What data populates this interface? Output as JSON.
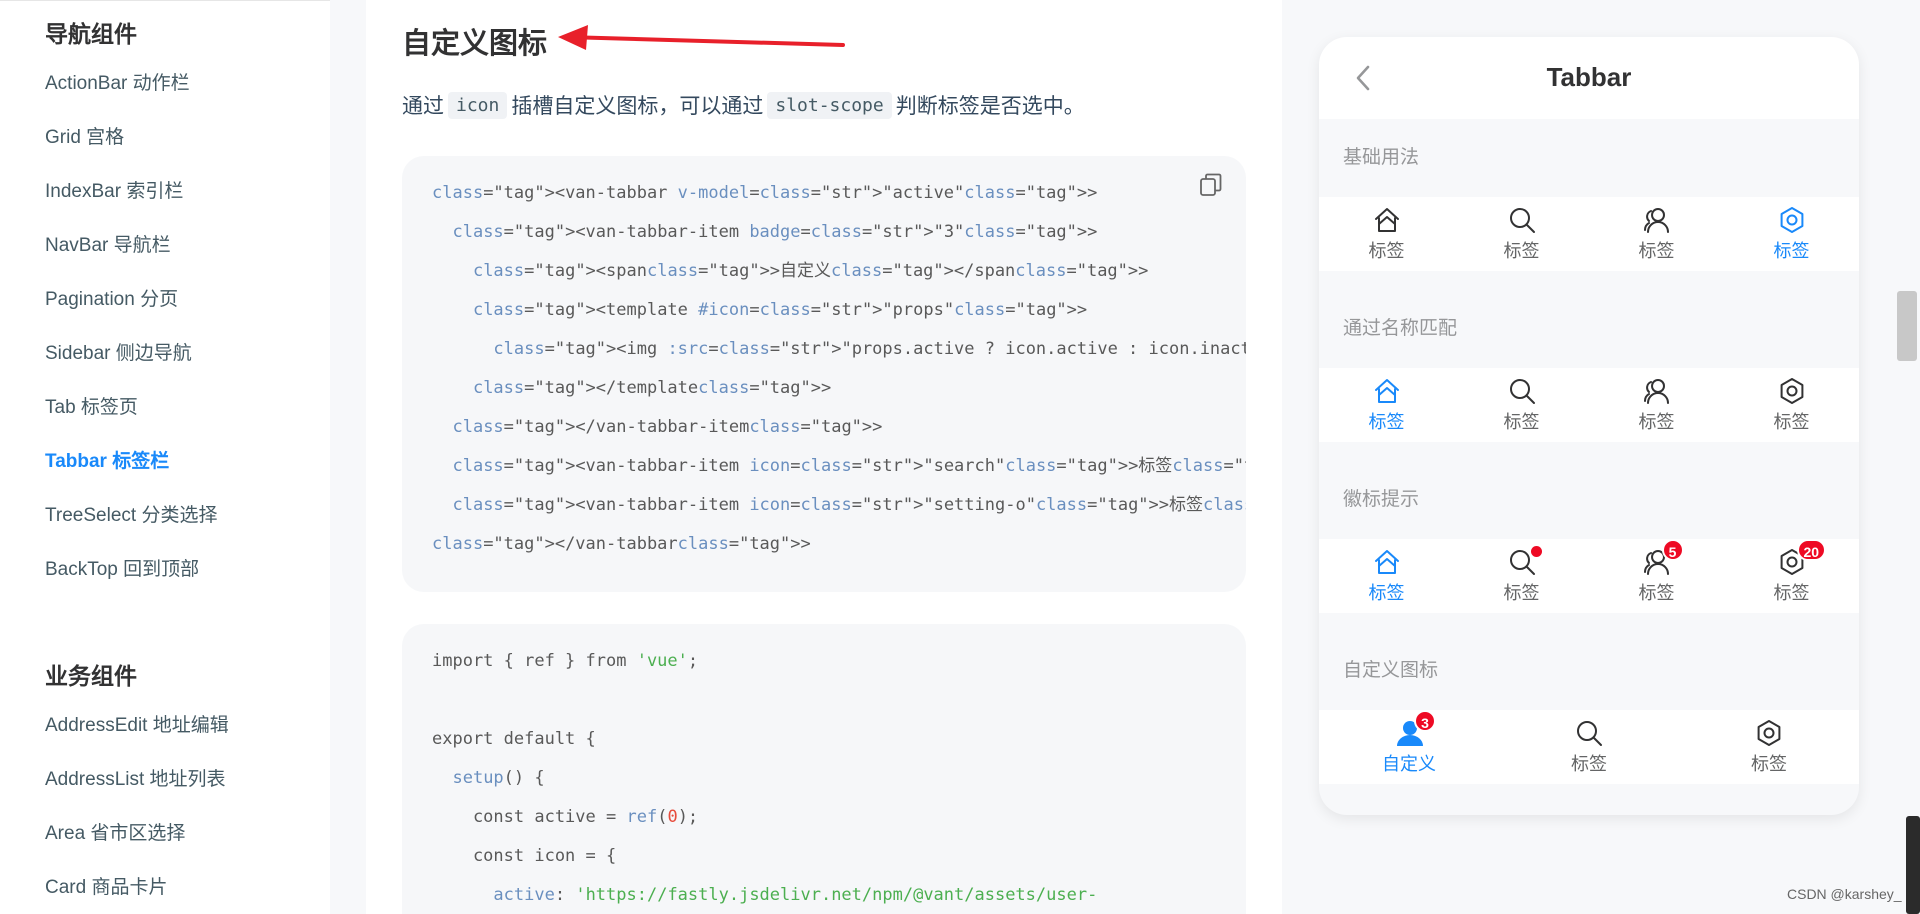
{
  "sidebar": {
    "nav_group_title": "导航组件",
    "nav_items": [
      "ActionBar 动作栏",
      "Grid 宫格",
      "IndexBar 索引栏",
      "NavBar 导航栏",
      "Pagination 分页",
      "Sidebar 侧边导航",
      "Tab 标签页",
      "Tabbar 标签栏",
      "TreeSelect 分类选择",
      "BackTop 回到顶部"
    ],
    "active_item": "Tabbar 标签栏",
    "biz_group_title": "业务组件",
    "biz_items": [
      "AddressEdit 地址编辑",
      "AddressList 地址列表",
      "Area 省市区选择",
      "Card 商品卡片"
    ]
  },
  "main": {
    "heading": "自定义图标",
    "desc_prefix": "通过",
    "desc_code1": "icon",
    "desc_mid": "插槽自定义图标，可以通过",
    "desc_code2": "slot-scope",
    "desc_suffix": "判断标签是否选中。",
    "template_lines": [
      "<van-tabbar v-model=\"active\">",
      "  <van-tabbar-item badge=\"3\">",
      "    <span>自定义</span>",
      "    <template #icon=\"props\">",
      "      <img :src=\"props.active ? icon.active : icon.inactive\" />",
      "    </template>",
      "  </van-tabbar-item>",
      "  <van-tabbar-item icon=\"search\">标签</van-tabbar-item>",
      "  <van-tabbar-item icon=\"setting-o\">标签</van-tabbar-item>",
      "</van-tabbar>"
    ],
    "script_lines": [
      "import { ref } from 'vue';",
      "",
      "export default {",
      "  setup() {",
      "    const active = ref(0);",
      "    const icon = {",
      "      active: 'https://fastly.jsdelivr.net/npm/@vant/assets/user-"
    ]
  },
  "phone": {
    "title": "Tabbar",
    "sections": [
      {
        "title": "基础用法",
        "tabs": [
          {
            "icon": "home-icon",
            "label": "标签",
            "active": false
          },
          {
            "icon": "search-icon",
            "label": "标签",
            "active": false
          },
          {
            "icon": "friends-icon",
            "label": "标签",
            "active": false
          },
          {
            "icon": "setting-icon",
            "label": "标签",
            "active": true
          }
        ]
      },
      {
        "title": "通过名称匹配",
        "tabs": [
          {
            "icon": "home-icon",
            "label": "标签",
            "active": true
          },
          {
            "icon": "search-icon",
            "label": "标签",
            "active": false
          },
          {
            "icon": "friends-icon",
            "label": "标签",
            "active": false
          },
          {
            "icon": "setting-icon",
            "label": "标签",
            "active": false
          }
        ]
      },
      {
        "title": "徽标提示",
        "tabs": [
          {
            "icon": "home-icon",
            "label": "标签",
            "active": true
          },
          {
            "icon": "search-icon",
            "label": "标签",
            "active": false,
            "dot": true
          },
          {
            "icon": "friends-icon",
            "label": "标签",
            "active": false,
            "badge": "5"
          },
          {
            "icon": "setting-icon",
            "label": "标签",
            "active": false,
            "badge": "20"
          }
        ]
      },
      {
        "title": "自定义图标",
        "tabs": [
          {
            "icon": "user-filled-icon",
            "label": "自定义",
            "active": true,
            "badge": "3"
          },
          {
            "icon": "search-icon",
            "label": "标签",
            "active": false
          },
          {
            "icon": "setting-icon",
            "label": "标签",
            "active": false
          }
        ]
      }
    ]
  },
  "watermark": "CSDN @karshey_",
  "colors": {
    "accent": "#1989fa",
    "badge": "#ee0a24",
    "arrow": "#e8202a"
  }
}
